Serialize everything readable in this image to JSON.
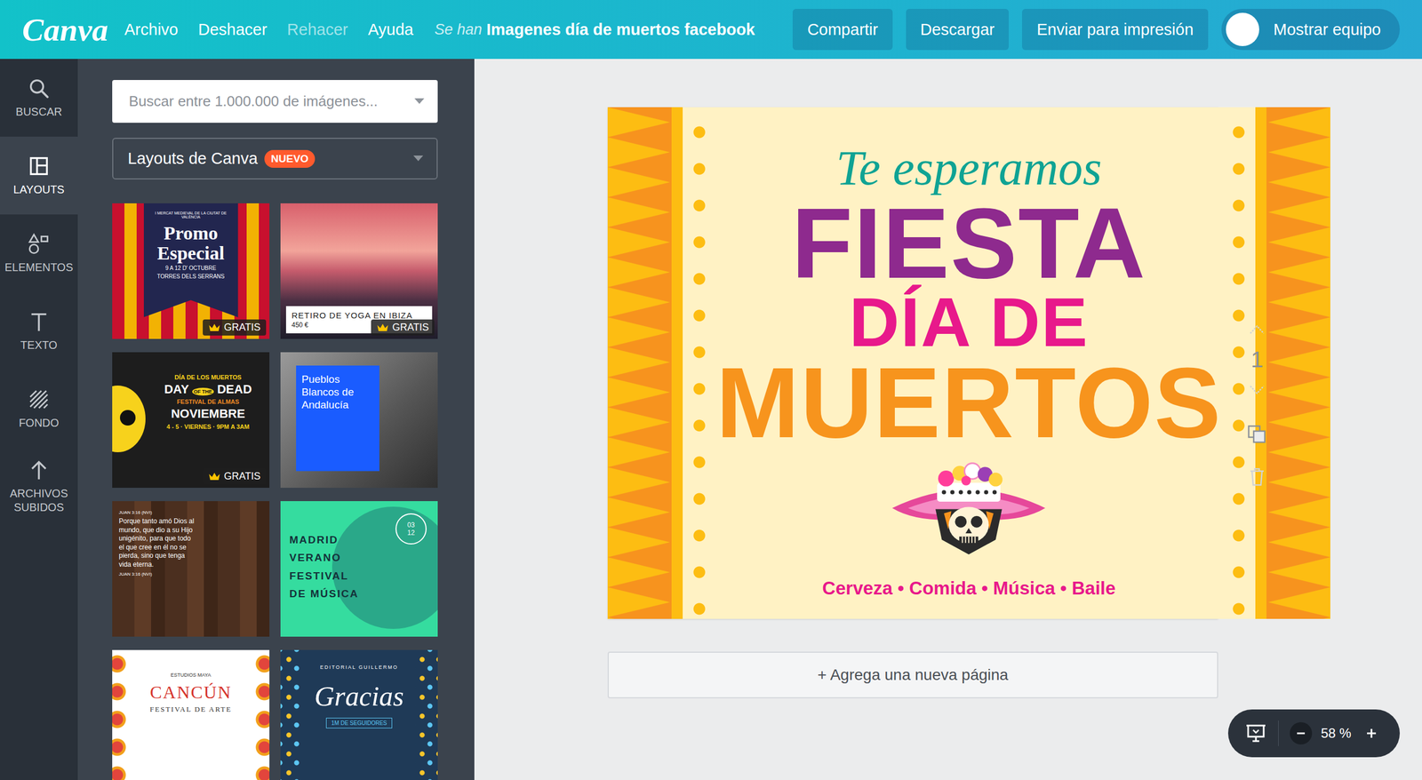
{
  "app": {
    "logo": "Canva",
    "status": "Se han",
    "document_title": "Imagenes día de muertos facebook"
  },
  "menu": [
    {
      "label": "Archivo",
      "disabled": false
    },
    {
      "label": "Deshacer",
      "disabled": false
    },
    {
      "label": "Rehacer",
      "disabled": true
    },
    {
      "label": "Ayuda",
      "disabled": false
    }
  ],
  "actions": [
    "Compartir",
    "Descargar",
    "Enviar para impresión"
  ],
  "team_button": "Mostrar equipo",
  "rail": [
    {
      "label": "BUSCAR",
      "kind": "search",
      "selected": false
    },
    {
      "label": "LAYOUTS",
      "kind": "layouts",
      "selected": true
    },
    {
      "label": "ELEMENTOS",
      "kind": "elements",
      "selected": false
    },
    {
      "label": "TEXTO",
      "kind": "text",
      "selected": false
    },
    {
      "label": "FONDO",
      "kind": "background",
      "selected": false
    },
    {
      "label": "ARCHIVOS SUBIDOS",
      "kind": "uploads",
      "selected": false
    }
  ],
  "panel": {
    "search_placeholder": "Buscar entre 1.000.000 de imágenes...",
    "dropdown": {
      "label": "Layouts de Canva",
      "badge": "NUEVO"
    }
  },
  "layouts": [
    {
      "kind": "promo",
      "badge": "GRATIS",
      "texts": [
        "I MERCAT MEDIEVAL DE LA CIUTAT DE VALÈNCIA",
        "Promo",
        "Especial",
        "9 A 12 D' OCTUBRE",
        "TORRES DELS SERRANS"
      ]
    },
    {
      "kind": "yoga",
      "badge": "GRATIS",
      "texts": [
        "RETIRO DE YOGA EN IBIZA",
        "450 €"
      ]
    },
    {
      "kind": "dead",
      "badge": "GRATIS",
      "texts": [
        "DÍA DE LOS MUERTOS",
        "DAY",
        "OF THE",
        "DEAD",
        "FESTIVAL DE ALMAS",
        "NOVIEMBRE",
        "4 - 5 · VIERNES · 9PM A 3AM"
      ]
    },
    {
      "kind": "pueblos",
      "badge": "",
      "texts": [
        "Pueblos Blancos de Andalucía"
      ]
    },
    {
      "kind": "verse",
      "badge": "",
      "texts": [
        "JUAN 3:16 (NVI)",
        "Porque tanto amó Dios al mundo, que dio a su Hijo unigénito, para que todo el que cree en él no se pierda, sino que tenga vida eterna.",
        "JUAN 3:16 (NVI)"
      ]
    },
    {
      "kind": "madrid",
      "badge": "",
      "texts": [
        "MADRID",
        "VERANO",
        "FESTIVAL",
        "DE MÚSICA",
        "03",
        "12"
      ]
    },
    {
      "kind": "cancun",
      "badge": "",
      "texts": [
        "ESTUDIOS MAYA",
        "CANCÚN",
        "FESTIVAL DE ARTE"
      ]
    },
    {
      "kind": "gracias",
      "badge": "",
      "texts": [
        "EDITORIAL",
        "GUILLERMO",
        "Gracias",
        "1M DE SEGUIDORES"
      ]
    }
  ],
  "design": {
    "kicker": "Te esperamos",
    "lines": [
      {
        "text": "FIESTA",
        "color": "#8e2a8e"
      },
      {
        "text": "DÍA DE",
        "color": "#e8198b"
      },
      {
        "text": "MUERTOS",
        "color": "#f7941d"
      }
    ],
    "footer": "Cerveza • Comida • Música • Baile"
  },
  "add_page": "+ Agrega una nueva página",
  "page_controls": {
    "page": "1",
    "up_disabled": true,
    "down_disabled": true,
    "delete_disabled": true
  },
  "zoom": {
    "value": "58 %"
  }
}
